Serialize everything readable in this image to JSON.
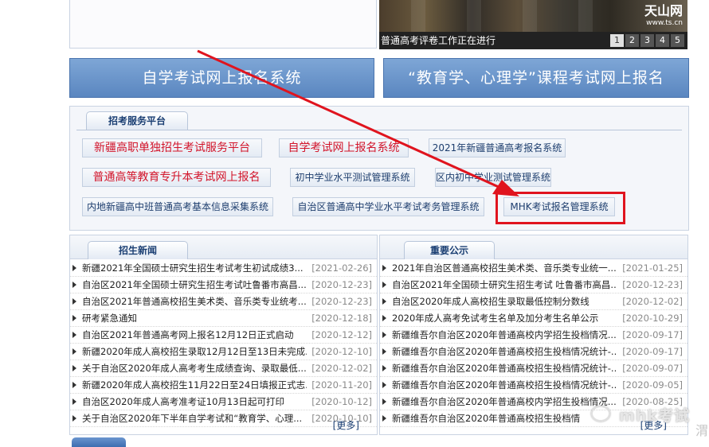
{
  "slideshow": {
    "caption": "普通高考评卷工作正在进行",
    "logo_text": "天山网",
    "logo_sub": "www.ts.cn",
    "pages": [
      "1",
      "2",
      "3",
      "4",
      "5"
    ]
  },
  "banners": {
    "self_exam": "自学考试网上报名系统",
    "course_exam": "“教育学、心理学”课程考试网上报名"
  },
  "service_platform": {
    "tab_label": "招考服务平台",
    "buttons": [
      "新疆高职单独招生考试服务平台",
      "自学考试网上报名系统",
      "2021年新疆普通高考报名系统",
      "普通高等教育专升本考试网上报名",
      "初中学业水平测试管理系统",
      "区内初中学业测试管理系统",
      "内地新疆高中班普通高考基本信息采集系统",
      "自治区普通高中学业水平考试考务管理系统",
      "MHK考试报名管理系统"
    ]
  },
  "news": {
    "tab_label": "招生新闻",
    "more": "[更多]",
    "items": [
      {
        "title": "新疆2021年全国硕士研究生招生考试考生初试成绩3...",
        "date": "[2021-02-26]"
      },
      {
        "title": "自治区2021年全国硕士研究生招生考试吐鲁番市高昌...",
        "date": "[2020-12-23]"
      },
      {
        "title": "自治区2021年普通高校招生美术类、音乐类专业统考...",
        "date": "[2020-12-23]"
      },
      {
        "title": "研考紧急通知",
        "date": "[2020-12-18]"
      },
      {
        "title": "自治区2021年普通高考网上报名12月12日正式启动",
        "date": "[2020-12-12]"
      },
      {
        "title": "新疆2020年成人高校招生录取12月12日至13日未完成...",
        "date": "[2020-12-10]"
      },
      {
        "title": "关于自治区2020年成人高考考生成绩查询、录取最低...",
        "date": "[2020-12-02]"
      },
      {
        "title": "新疆2020年成人高校招生11月22日至24日填报正式志...",
        "date": "[2020-11-20]"
      },
      {
        "title": "自治区2020年成人高考准考证10月13日起可打印",
        "date": "[2020-10-12]"
      },
      {
        "title": "关于自治区2020年下半年自学考试和“教育学、心理...",
        "date": "[2020-10-10]"
      }
    ]
  },
  "notices": {
    "tab_label": "重要公示",
    "more": "[更多]",
    "items": [
      {
        "title": "2021年自治区普通高校招生美术类、音乐类专业统一...",
        "date": "[2021-01-25]"
      },
      {
        "title": "自治区2021年全国硕士研究生招生考试 吐鲁番市高昌...",
        "date": "[2020-12-23]"
      },
      {
        "title": "自治区2020年成人高校招生录取最低控制分数线",
        "date": "[2020-12-02]"
      },
      {
        "title": "2020年成人高考免试考生名单及加分考生名单公示",
        "date": "[2020-10-29]"
      },
      {
        "title": "新疆维吾尔自治区2020年普通高校内学招生投档情况...",
        "date": "[2020-09-17]"
      },
      {
        "title": "新疆维吾尔自治区2020年普通高校招生投档情况统计-...",
        "date": "[2020-09-17]"
      },
      {
        "title": "新疆维吾尔自治区2020年普通高校招生投档情况统计-...",
        "date": "[2020-09-07]"
      },
      {
        "title": "新疆维吾尔自治区2020年普通高校招生投档情况统计-...",
        "date": "[2020-09-05]"
      },
      {
        "title": "新疆维吾尔自治区2020年普通高校内学招生投档情况...",
        "date": "[2020-08-25]"
      },
      {
        "title": "新疆维吾尔自治区2020年普通高校招生投档情",
        "date": ""
      }
    ]
  },
  "watermark": {
    "text": "mhk考试",
    "side_char": "渭"
  },
  "colors": {
    "banner_blue": "#5a86c0",
    "highlight_red": "#e0141e",
    "link_red": "#d2142a",
    "link_blue": "#1e3e6e"
  }
}
